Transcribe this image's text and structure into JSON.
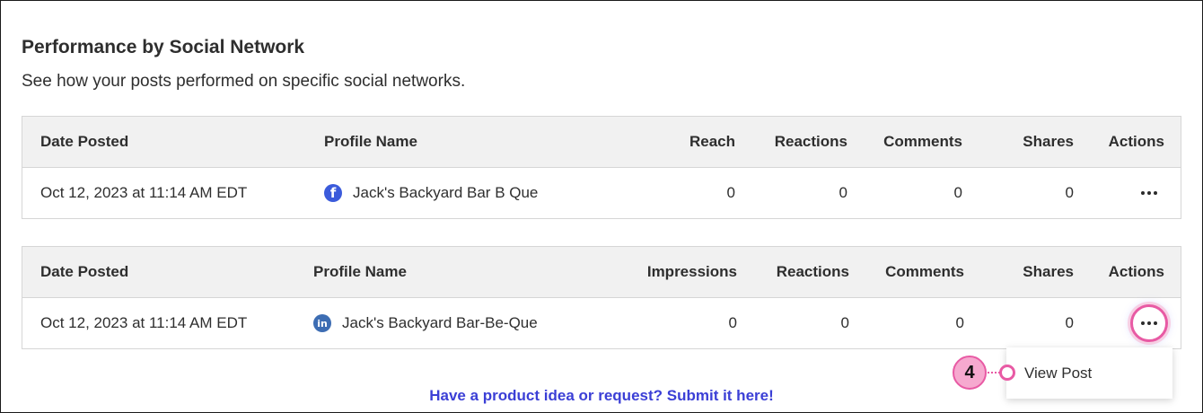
{
  "section": {
    "title": "Performance by Social Network",
    "subtitle": "See how your posts performed on specific social networks."
  },
  "facebook_table": {
    "headers": {
      "date": "Date Posted",
      "profile": "Profile Name",
      "metric": "Reach",
      "reactions": "Reactions",
      "comments": "Comments",
      "shares": "Shares",
      "actions": "Actions"
    },
    "row": {
      "date": "Oct 12, 2023 at 11:14 AM EDT",
      "network_icon": "facebook-icon",
      "network_glyph": "f",
      "profile": "Jack's Backyard Bar B Que",
      "metric": "0",
      "reactions": "0",
      "comments": "0",
      "shares": "0"
    }
  },
  "linkedin_table": {
    "headers": {
      "date": "Date Posted",
      "profile": "Profile Name",
      "metric": "Impressions",
      "reactions": "Reactions",
      "comments": "Comments",
      "shares": "Shares",
      "actions": "Actions"
    },
    "row": {
      "date": "Oct 12, 2023 at 11:14 AM EDT",
      "network_icon": "linkedin-icon",
      "network_glyph": "in",
      "profile": "Jack's Backyard Bar-Be-Que",
      "metric": "0",
      "reactions": "0",
      "comments": "0",
      "shares": "0"
    }
  },
  "actions_menu": {
    "items": [
      "View Post"
    ]
  },
  "callout": {
    "number": "4",
    "color": "#e85aa4"
  },
  "footer": {
    "link_text": "Have a product idea or request? Submit it here!",
    "link_color": "#3b3fd6"
  }
}
